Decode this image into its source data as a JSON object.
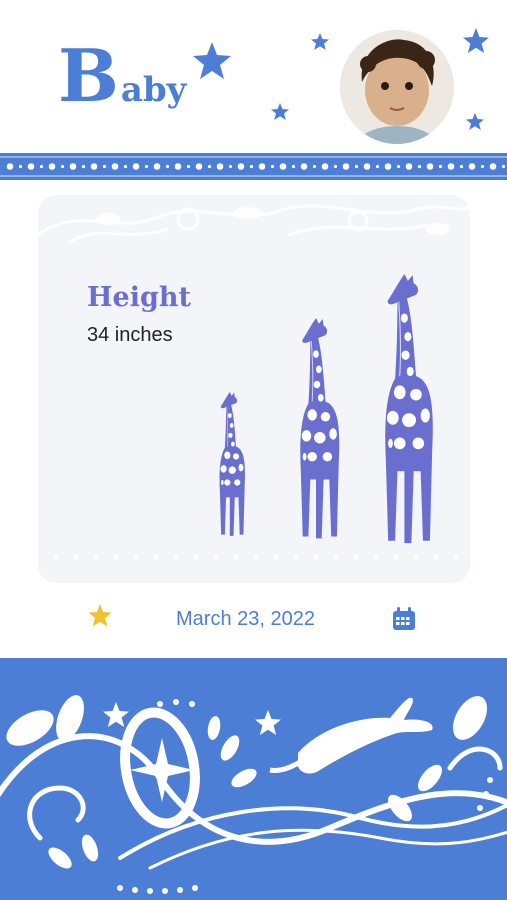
{
  "header": {
    "title_initial": "B",
    "title_rest": "aby",
    "accent_color": "#4d7ed6"
  },
  "avatar": {
    "icon": "baby-photo"
  },
  "measurement": {
    "label": "Height",
    "value": "34 inches"
  },
  "date_row": {
    "date": "March 23, 2022",
    "star_icon": "star-icon",
    "calendar_icon": "calendar-icon"
  },
  "colors": {
    "primary": "#4d7ed6",
    "card": "#f4f5f9",
    "giraffe": "#6a6fcf",
    "star_gold": "#f2c12e"
  }
}
